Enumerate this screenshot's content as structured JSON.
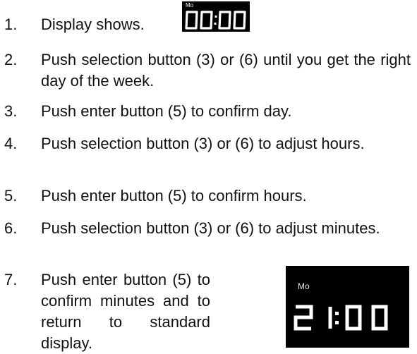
{
  "steps": [
    {
      "num": "1.",
      "text": "Display shows."
    },
    {
      "num": "2.",
      "text": "Push selection button (3) or (6) until you get the right day of the week."
    },
    {
      "num": "3.",
      "text": "Push enter button (5) to confirm day."
    },
    {
      "num": "4.",
      "text": "Push selection button (3) or (6) to adjust hours."
    },
    {
      "num": "5.",
      "text": "Push enter button (5) to confirm hours."
    },
    {
      "num": "6.",
      "text": "Push selection button (3) or (6) to adjust minutes."
    },
    {
      "num": "7.",
      "text": "Push enter button (5) to confirm minutes and to return to standard display."
    }
  ],
  "display_small": {
    "day": "Mo",
    "time": "00:00"
  },
  "display_large": {
    "day": "Mo",
    "time": "21:00"
  },
  "colors": {
    "display_background": "#000000",
    "display_text": "#ffffff"
  }
}
